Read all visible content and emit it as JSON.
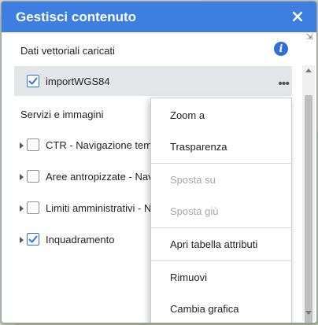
{
  "panel": {
    "title": "Gestisci contenuto",
    "close_icon": "close-icon"
  },
  "vector_section": {
    "title": "Dati vettoriali caricati",
    "info_icon": "info-icon",
    "items": [
      {
        "label": "importWGS84",
        "checked": true
      }
    ]
  },
  "services_section": {
    "title": "Servizi e immagini",
    "items": [
      {
        "label": "CTR - Navigazione temporale",
        "checked": false,
        "expandable": true
      },
      {
        "label": "Aree antropizzate - Navigazione temporale",
        "checked": false,
        "expandable": true
      },
      {
        "label": "Limiti amministrativi - Navigazione temporale",
        "checked": false,
        "expandable": true
      },
      {
        "label": "Inquadramento",
        "checked": true,
        "expandable": true
      }
    ]
  },
  "context_menu": {
    "items": [
      {
        "label": "Zoom a",
        "enabled": true
      },
      {
        "label": "Trasparenza",
        "enabled": true
      },
      {
        "label": "Sposta su",
        "enabled": false
      },
      {
        "label": "Sposta giù",
        "enabled": false
      },
      {
        "label": "Apri tabella attributi",
        "enabled": true
      },
      {
        "label": "Rimuovi",
        "enabled": true
      },
      {
        "label": "Cambia grafica",
        "enabled": true
      }
    ]
  },
  "colors": {
    "header": "#3d7fe0",
    "accent": "#2e73d9",
    "selected_row": "#e3e5e8",
    "disabled_text": "#a3a7ac"
  }
}
